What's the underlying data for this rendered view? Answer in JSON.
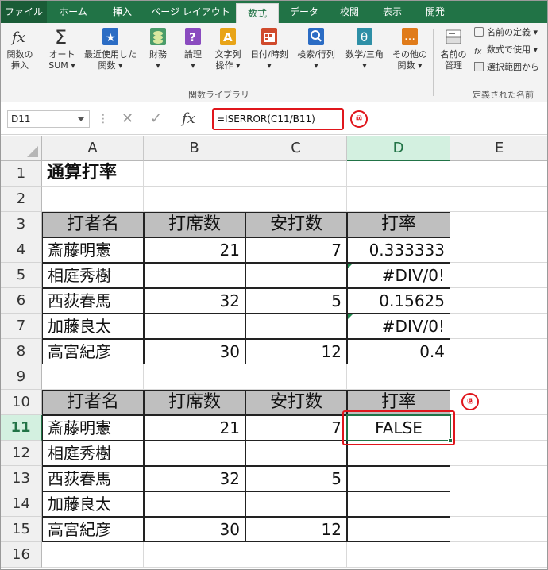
{
  "tabs": [
    {
      "label": "ファイル",
      "key": "file"
    },
    {
      "label": "ホーム",
      "key": "home"
    },
    {
      "label": "挿入",
      "key": "insert"
    },
    {
      "label": "ページ レイアウト",
      "key": "layout"
    },
    {
      "label": "数式",
      "key": "formulas"
    },
    {
      "label": "データ",
      "key": "data"
    },
    {
      "label": "校閲",
      "key": "review"
    },
    {
      "label": "表示",
      "key": "view"
    },
    {
      "label": "開発",
      "key": "dev"
    }
  ],
  "active_tab": "数式",
  "ribbon": {
    "buttons": [
      {
        "line1": "関数の",
        "line2": "挿入",
        "icon": "fx-icon"
      },
      {
        "line1": "オート",
        "line2": "SUM ▾",
        "icon": "sigma-icon"
      },
      {
        "line1": "最近使用した",
        "line2": "関数 ▾",
        "icon": "star-book-icon"
      },
      {
        "line1": "財務",
        "line2": "▾",
        "icon": "coins-icon"
      },
      {
        "line1": "論理",
        "line2": "▾",
        "icon": "question-book-icon"
      },
      {
        "line1": "文字列",
        "line2": "操作 ▾",
        "icon": "text-book-icon"
      },
      {
        "line1": "日付/時刻",
        "line2": "▾",
        "icon": "calendar-icon"
      },
      {
        "line1": "検索/行列",
        "line2": "▾",
        "icon": "search-book-icon"
      },
      {
        "line1": "数学/三角",
        "line2": "▾",
        "icon": "theta-book-icon"
      },
      {
        "line1": "その他の",
        "line2": "関数 ▾",
        "icon": "more-book-icon"
      },
      {
        "line1": "名前の",
        "line2": "管理",
        "icon": "name-manager-icon"
      }
    ],
    "group_function_library": "関数ライブラリ",
    "group_defined_names": "定義された名前",
    "defined_names_items": [
      "名前の定義 ▾",
      "数式で使用 ▾",
      "選択範囲から"
    ]
  },
  "formula_bar": {
    "name_box": "D11",
    "fx": "fx",
    "formula": "=ISERROR(C11/B11)",
    "callout": "⑩"
  },
  "sheet": {
    "columns": [
      "A",
      "B",
      "C",
      "D",
      "E"
    ],
    "selected_column": "D",
    "selected_row": "11",
    "rows": [
      {
        "num": "1",
        "cells": [
          "通算打率",
          "",
          "",
          "",
          ""
        ]
      },
      {
        "num": "2",
        "cells": [
          "",
          "",
          "",
          "",
          ""
        ]
      },
      {
        "num": "3",
        "cells": [
          "打者名",
          "打席数",
          "安打数",
          "打率",
          ""
        ]
      },
      {
        "num": "4",
        "cells": [
          "斎藤明憲",
          "21",
          "7",
          "0.333333",
          ""
        ]
      },
      {
        "num": "5",
        "cells": [
          "相庭秀樹",
          "",
          "",
          "#DIV/0!",
          ""
        ]
      },
      {
        "num": "6",
        "cells": [
          "西荻春馬",
          "32",
          "5",
          "0.15625",
          ""
        ]
      },
      {
        "num": "7",
        "cells": [
          "加藤良太",
          "",
          "",
          "#DIV/0!",
          ""
        ]
      },
      {
        "num": "8",
        "cells": [
          "高宮紀彦",
          "30",
          "12",
          "0.4",
          ""
        ]
      },
      {
        "num": "9",
        "cells": [
          "",
          "",
          "",
          "",
          ""
        ]
      },
      {
        "num": "10",
        "cells": [
          "打者名",
          "打席数",
          "安打数",
          "打率",
          ""
        ]
      },
      {
        "num": "11",
        "cells": [
          "斎藤明憲",
          "21",
          "7",
          "FALSE",
          ""
        ]
      },
      {
        "num": "12",
        "cells": [
          "相庭秀樹",
          "",
          "",
          "",
          ""
        ]
      },
      {
        "num": "13",
        "cells": [
          "西荻春馬",
          "32",
          "5",
          "",
          ""
        ]
      },
      {
        "num": "14",
        "cells": [
          "加藤良太",
          "",
          "",
          "",
          ""
        ]
      },
      {
        "num": "15",
        "cells": [
          "高宮紀彦",
          "30",
          "12",
          "",
          ""
        ]
      },
      {
        "num": "16",
        "cells": [
          "",
          "",
          "",
          "",
          ""
        ]
      }
    ],
    "callout_cell": "⑨"
  },
  "colors": {
    "excel_green": "#217346",
    "header_fill": "#bfbfbf",
    "annotation_red": "#e0161c"
  }
}
